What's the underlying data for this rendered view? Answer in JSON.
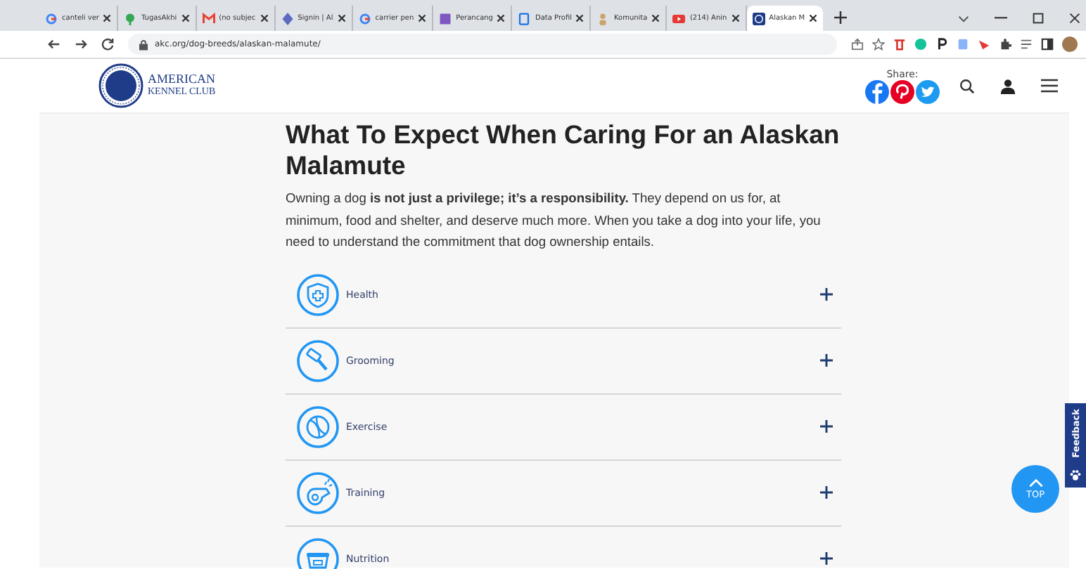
{
  "browser": {
    "tabs": [
      {
        "title": "canteli ver",
        "kind": "google",
        "selected": false
      },
      {
        "title": "TugasAkhi",
        "kind": "pin",
        "selected": false
      },
      {
        "title": "(no subjec",
        "kind": "mail",
        "selected": false
      },
      {
        "title": "Signin | Al",
        "kind": "signin",
        "selected": false
      },
      {
        "title": "carrier pen",
        "kind": "google",
        "selected": false
      },
      {
        "title": "Perancang",
        "kind": "square",
        "selected": false
      },
      {
        "title": "Data Profil",
        "kind": "doc",
        "selected": false
      },
      {
        "title": "Komunita",
        "kind": "person",
        "selected": false
      },
      {
        "title": "(214) Anin",
        "kind": "video",
        "selected": false
      },
      {
        "title": "Alaskan M",
        "kind": "akc",
        "selected": true
      }
    ],
    "url": "akc.org/dog-breeds/alaskan-malamute/"
  },
  "header": {
    "logo_line_1": "AMERICAN",
    "logo_line_2": "KENNEL CLUB",
    "share_label": "Share:"
  },
  "article": {
    "title": "What To Expect When Caring For an Alaskan Malamute",
    "intro": "Owning a dog **is not just a privilege; it’s a responsibility.** They depend on us for, at minimum, food and shelter, and deserve much more. When you take a dog into your life, you need to understand the commitment that dog ownership entails.",
    "sections": [
      {
        "label": "Health",
        "kind": "health",
        "expanded": false
      },
      {
        "label": "Grooming",
        "kind": "grooming",
        "expanded": false
      },
      {
        "label": "Exercise",
        "kind": "exercise",
        "expanded": false
      },
      {
        "label": "Training",
        "kind": "training",
        "expanded": false
      },
      {
        "label": "Nutrition",
        "kind": "nutrition",
        "expanded": false
      }
    ]
  },
  "feedback_tab": "Feedback",
  "top_button": "TOP"
}
